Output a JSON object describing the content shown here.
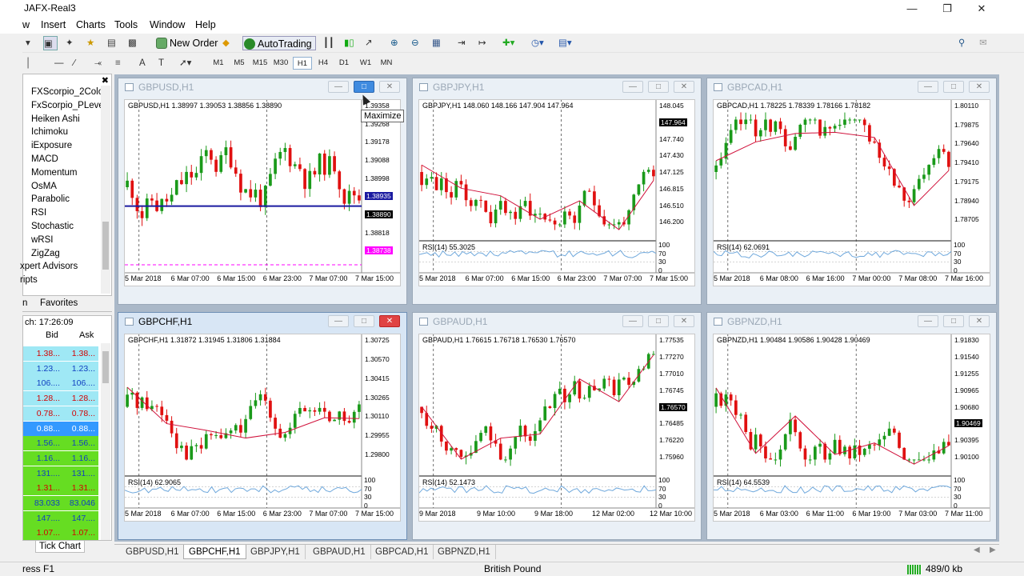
{
  "app": {
    "title": "JAFX-Real3"
  },
  "menu": [
    "w",
    "Insert",
    "Charts",
    "Tools",
    "Window",
    "Help"
  ],
  "toolbar": {
    "new_order": "New Order",
    "autotrading": "AutoTrading",
    "timeframes": [
      "M1",
      "M5",
      "M15",
      "M30",
      "H1",
      "H4",
      "D1",
      "W1",
      "MN"
    ],
    "active_timeframe": "H1"
  },
  "navigator": {
    "items": [
      "FXScorpio_2Colo",
      "FxScorpio_PLevel",
      "Heiken Ashi",
      "Ichimoku",
      "iExposure",
      "MACD",
      "Momentum",
      "OsMA",
      "Parabolic",
      "RSI",
      "Stochastic",
      "wRSI",
      "ZigZag",
      "xpert Advisors",
      "ripts"
    ],
    "tabs": [
      "n",
      "Favorites"
    ]
  },
  "market_watch": {
    "header": "ch: 17:26:09",
    "col_bid": "Bid",
    "col_ask": "Ask",
    "rows": [
      {
        "bid": "1.38...",
        "ask": "1.38...",
        "bg": "#9fe8f5",
        "color": "#d40000"
      },
      {
        "bid": "1.23...",
        "ask": "1.23...",
        "bg": "#9fe8f5",
        "color": "#1040c0"
      },
      {
        "bid": "106....",
        "ask": "106....",
        "bg": "#9fe8f5",
        "color": "#1040c0"
      },
      {
        "bid": "1.28...",
        "ask": "1.28...",
        "bg": "#9fe8f5",
        "color": "#d40000"
      },
      {
        "bid": "0.78...",
        "ask": "0.78...",
        "bg": "#9fe8f5",
        "color": "#d40000"
      },
      {
        "bid": "0.88...",
        "ask": "0.88...",
        "bg": "#3399ff",
        "color": "#ffffff"
      },
      {
        "bid": "1.56...",
        "ask": "1.56...",
        "bg": "#66dd22",
        "color": "#1040c0"
      },
      {
        "bid": "1.16...",
        "ask": "1.16...",
        "bg": "#66dd22",
        "color": "#1040c0"
      },
      {
        "bid": "131....",
        "ask": "131....",
        "bg": "#66dd22",
        "color": "#1040c0"
      },
      {
        "bid": "1.31...",
        "ask": "1.31...",
        "bg": "#66dd22",
        "color": "#d40000"
      },
      {
        "bid": "83.033",
        "ask": "83.046",
        "bg": "#66dd22",
        "color": "#1040c0"
      },
      {
        "bid": "147....",
        "ask": "147....",
        "bg": "#66dd22",
        "color": "#1040c0"
      },
      {
        "bid": "1.07...",
        "ask": "1.07...",
        "bg": "#66dd22",
        "color": "#d40000"
      }
    ],
    "tab": "Tick Chart"
  },
  "charts": [
    {
      "title": "GBPUSD,H1",
      "info": "GBPUSD,H1  1.38997 1.39053 1.38856 1.38890",
      "prices": [
        "1.39358",
        "1.39268",
        "1.39178",
        "1.39088",
        "1.38998",
        "1.38935",
        "1.38890",
        "1.38818",
        "1.38738"
      ],
      "times": [
        "5 Mar 2018",
        "6 Mar 07:00",
        "6 Mar 15:00",
        "6 Mar 23:00",
        "7 Mar 07:00",
        "7 Mar 15:00"
      ],
      "bid_label": "1.38890",
      "hline_label": "1.38935",
      "pink_label": "1.38738",
      "rsi": "",
      "seed": 11
    },
    {
      "title": "GBPJPY,H1",
      "info": "GBPJPY,H1  148.060 148.166 147.904 147.964",
      "prices": [
        "148.045",
        "147.964",
        "147.740",
        "147.430",
        "147.125",
        "146.815",
        "146.510",
        "146.200"
      ],
      "times": [
        "5 Mar 2018",
        "6 Mar 07:00",
        "6 Mar 15:00",
        "6 Mar 23:00",
        "7 Mar 07:00",
        "7 Mar 15:00"
      ],
      "bid_label": "147.964",
      "rsi": "RSI(14) 55.3025",
      "seed": 23
    },
    {
      "title": "GBPCAD,H1",
      "info": "GBPCAD,H1  1.78225 1.78339 1.78166 1.78182",
      "prices": [
        "1.80110",
        "1.79875",
        "1.79640",
        "1.79410",
        "1.79175",
        "1.78940",
        "1.78705"
      ],
      "times": [
        "5 Mar 2018",
        "6 Mar 08:00",
        "6 Mar 16:00",
        "7 Mar 00:00",
        "7 Mar 08:00",
        "7 Mar 16:00"
      ],
      "bid_label": "",
      "rsi": "RSI(14) 62.0691",
      "seed": 37
    },
    {
      "title": "GBPCHF,H1",
      "info": "GBPCHF,H1  1.31872 1.31945 1.31806 1.31884",
      "prices": [
        "1.30725",
        "1.30570",
        "1.30415",
        "1.30265",
        "1.30110",
        "1.29955",
        "1.29800"
      ],
      "times": [
        "5 Mar 2018",
        "6 Mar 07:00",
        "6 Mar 15:00",
        "6 Mar 23:00",
        "7 Mar 07:00",
        "7 Mar 15:00"
      ],
      "bid_label": "",
      "rsi": "RSI(14) 62.9065",
      "seed": 41
    },
    {
      "title": "GBPAUD,H1",
      "info": "GBPAUD,H1  1.76615 1.76718 1.76530 1.76570",
      "prices": [
        "1.77535",
        "1.77270",
        "1.77010",
        "1.76745",
        "1.76570",
        "1.76485",
        "1.76220",
        "1.75960"
      ],
      "times": [
        "9 Mar 2018",
        "9 Mar 10:00",
        "9 Mar 18:00",
        "12 Mar 02:00",
        "12 Mar 10:00"
      ],
      "bid_label": "1.76570",
      "rsi": "RSI(14) 52.1473",
      "seed": 53
    },
    {
      "title": "GBPNZD,H1",
      "info": "GBPNZD,H1  1.90484 1.90586 1.90428 1.90469",
      "prices": [
        "1.91830",
        "1.91540",
        "1.91255",
        "1.90965",
        "1.90680",
        "1.90469",
        "1.90395",
        "1.90100"
      ],
      "times": [
        "5 Mar 2018",
        "6 Mar 03:00",
        "6 Mar 11:00",
        "6 Mar 19:00",
        "7 Mar 03:00",
        "7 Mar 11:00"
      ],
      "bid_label": "1.90469",
      "rsi": "RSI(14) 64.5539",
      "seed": 67
    }
  ],
  "rsi_levels": [
    "100",
    "70",
    "30",
    "0"
  ],
  "tooltip": "Maximize",
  "tabs": [
    "GBPUSD,H1",
    "GBPCHF,H1",
    "GBPJPY,H1",
    "GBPAUD,H1",
    "GBPCAD,H1",
    "GBPNZD,H1"
  ],
  "active_tab": "GBPCHF,H1",
  "status": {
    "help": "ress F1",
    "symbol": "British Pound",
    "traffic": "489/0 kb"
  },
  "colors": {
    "bull": "#1a9a1a",
    "bear": "#e01010",
    "zigzag": "#d0103a",
    "bid_line": "#1a1aa0",
    "pink": "#ff00ff",
    "rsi_line": "#6fa8dc"
  }
}
